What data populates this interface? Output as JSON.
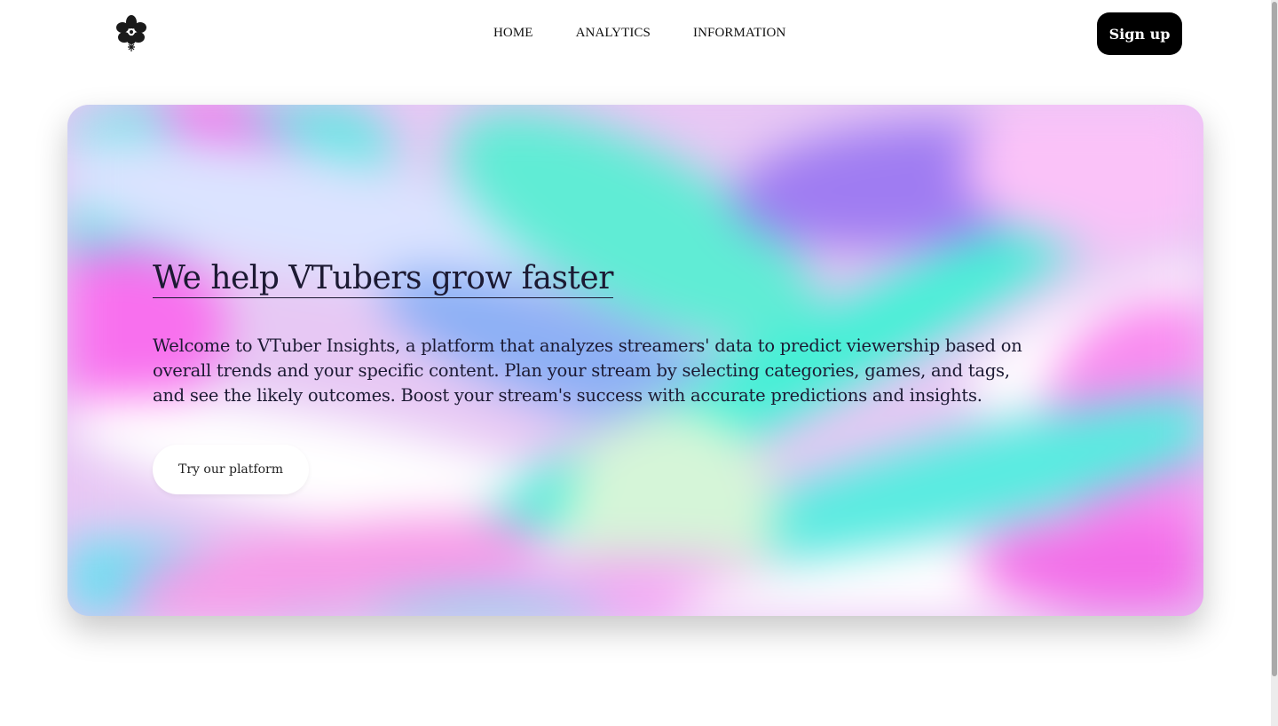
{
  "brand": {
    "logo_icon": "flower-icon"
  },
  "nav": {
    "items": [
      {
        "label": "HOME"
      },
      {
        "label": "ANALYTICS"
      },
      {
        "label": "INFORMATION"
      }
    ]
  },
  "header": {
    "signup_label": "Sign up"
  },
  "hero": {
    "title": "We help VTubers grow faster",
    "description": "Welcome to VTuber Insights, a platform that analyzes streamers' data to predict viewership based on overall trends and your specific content. Plan your stream by selecting categories, games, and tags, and see the likely outcomes. Boost your stream's success with accurate predictions and insights.",
    "cta_label": "Try our platform"
  },
  "colors": {
    "button_dark": "#000000",
    "text_dark": "#1c1a33",
    "holo_pink": "#f76cf0",
    "holo_cyan": "#4fe8d8",
    "holo_violet": "#9b7cf2"
  }
}
